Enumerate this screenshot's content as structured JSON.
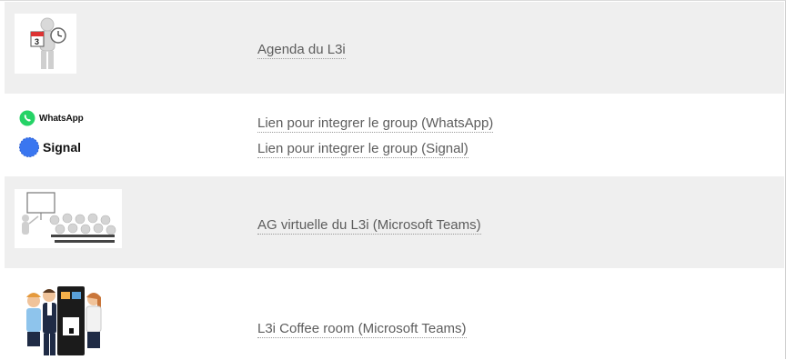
{
  "rows": [
    {
      "link": "Agenda du L3i",
      "icon": "calendar-clock-figure-icon"
    },
    {
      "brands": {
        "whatsapp": "WhatsApp",
        "signal": "Signal"
      },
      "links": [
        "Lien pour integrer le group (WhatsApp)",
        "Lien pour integrer le group (Signal)"
      ]
    },
    {
      "link": "AG virtuelle du L3i (Microsoft Teams)",
      "icon": "meeting-presentation-icon"
    },
    {
      "link": "L3i Coffee room (Microsoft Teams)",
      "icon": "coffee-machine-people-icon"
    }
  ],
  "colors": {
    "row_shade": "#efefef",
    "link_text": "#5d5d5d",
    "whatsapp_green": "#25d366",
    "signal_blue": "#3a76f0"
  }
}
